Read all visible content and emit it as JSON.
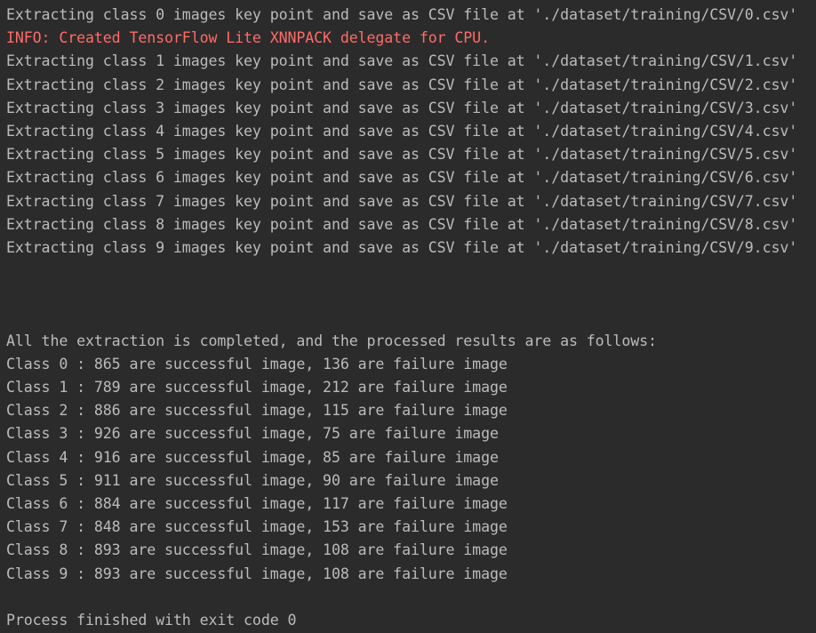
{
  "console": {
    "extract_lines": [
      "Extracting class 0 images key point and save as CSV file at './dataset/training/CSV/0.csv'",
      "INFO: Created TensorFlow Lite XNNPACK delegate for CPU.",
      "Extracting class 1 images key point and save as CSV file at './dataset/training/CSV/1.csv'",
      "Extracting class 2 images key point and save as CSV file at './dataset/training/CSV/2.csv'",
      "Extracting class 3 images key point and save as CSV file at './dataset/training/CSV/3.csv'",
      "Extracting class 4 images key point and save as CSV file at './dataset/training/CSV/4.csv'",
      "Extracting class 5 images key point and save as CSV file at './dataset/training/CSV/5.csv'",
      "Extracting class 6 images key point and save as CSV file at './dataset/training/CSV/6.csv'",
      "Extracting class 7 images key point and save as CSV file at './dataset/training/CSV/7.csv'",
      "Extracting class 8 images key point and save as CSV file at './dataset/training/CSV/8.csv'",
      "Extracting class 9 images key point and save as CSV file at './dataset/training/CSV/9.csv'"
    ],
    "summary_header": "All the extraction is completed, and the processed results are as follows:",
    "results": [
      "Class 0 : 865 are successful image, 136 are failure image",
      "Class 1 : 789 are successful image, 212 are failure image",
      "Class 2 : 886 are successful image, 115 are failure image",
      "Class 3 : 926 are successful image, 75 are failure image",
      "Class 4 : 916 are successful image, 85 are failure image",
      "Class 5 : 911 are successful image, 90 are failure image",
      "Class 6 : 884 are successful image, 117 are failure image",
      "Class 7 : 848 are successful image, 153 are failure image",
      "Class 8 : 893 are successful image, 108 are failure image",
      "Class 9 : 893 are successful image, 108 are failure image"
    ],
    "exit_message": "Process finished with exit code 0",
    "colors": {
      "background": "#2b2b2b",
      "text": "#bbbbbb",
      "error": "#ff6b68"
    }
  }
}
